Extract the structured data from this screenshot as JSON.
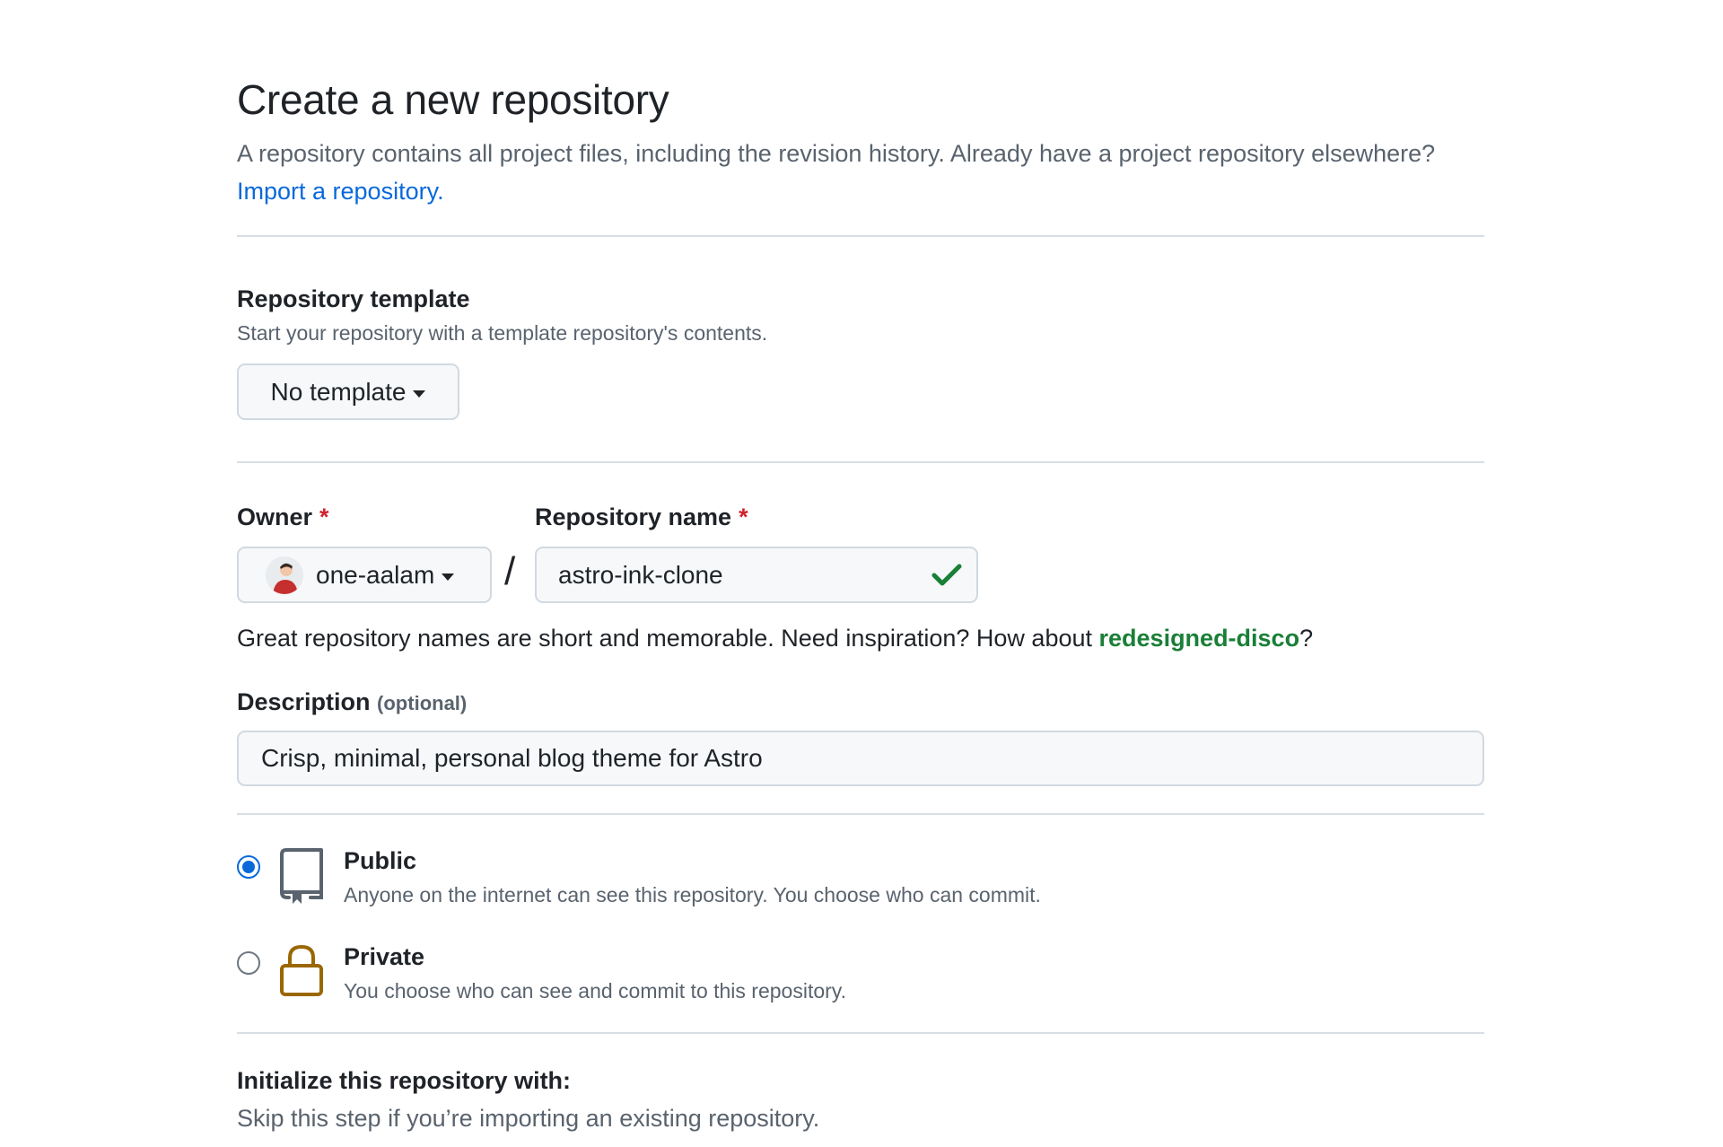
{
  "header": {
    "title": "Create a new repository",
    "subtitle": "A repository contains all project files, including the revision history. Already have a project repository elsewhere?",
    "import_link": "Import a repository."
  },
  "template": {
    "label": "Repository template",
    "note": "Start your repository with a template repository's contents.",
    "button_label": "No template"
  },
  "owner": {
    "label": "Owner",
    "required_mark": "*",
    "value": "one-aalam"
  },
  "repo_name": {
    "label": "Repository name",
    "required_mark": "*",
    "separator": "/",
    "value": "astro-ink-clone",
    "status_icon": "check-icon"
  },
  "hint": {
    "text": "Great repository names are short and memorable. Need inspiration? How about",
    "suggestion": "redesigned-disco",
    "suffix": "?"
  },
  "description": {
    "label": "Description",
    "optional": "(optional)",
    "value": "Crisp, minimal, personal blog theme for Astro"
  },
  "visibility": {
    "options": [
      {
        "title": "Public",
        "desc": "Anyone on the internet can see this repository. You choose who can commit.",
        "icon": "repo-icon",
        "selected": true
      },
      {
        "title": "Private",
        "desc": "You choose who can see and commit to this repository.",
        "icon": "lock-icon",
        "selected": false
      }
    ]
  },
  "initialize": {
    "title": "Initialize this repository with:",
    "note": "Skip this step if you’re importing an existing repository."
  },
  "colors": {
    "accent": "#0969da",
    "success": "#1a7f37",
    "required": "#cf222e",
    "lock": "#9a6700"
  }
}
